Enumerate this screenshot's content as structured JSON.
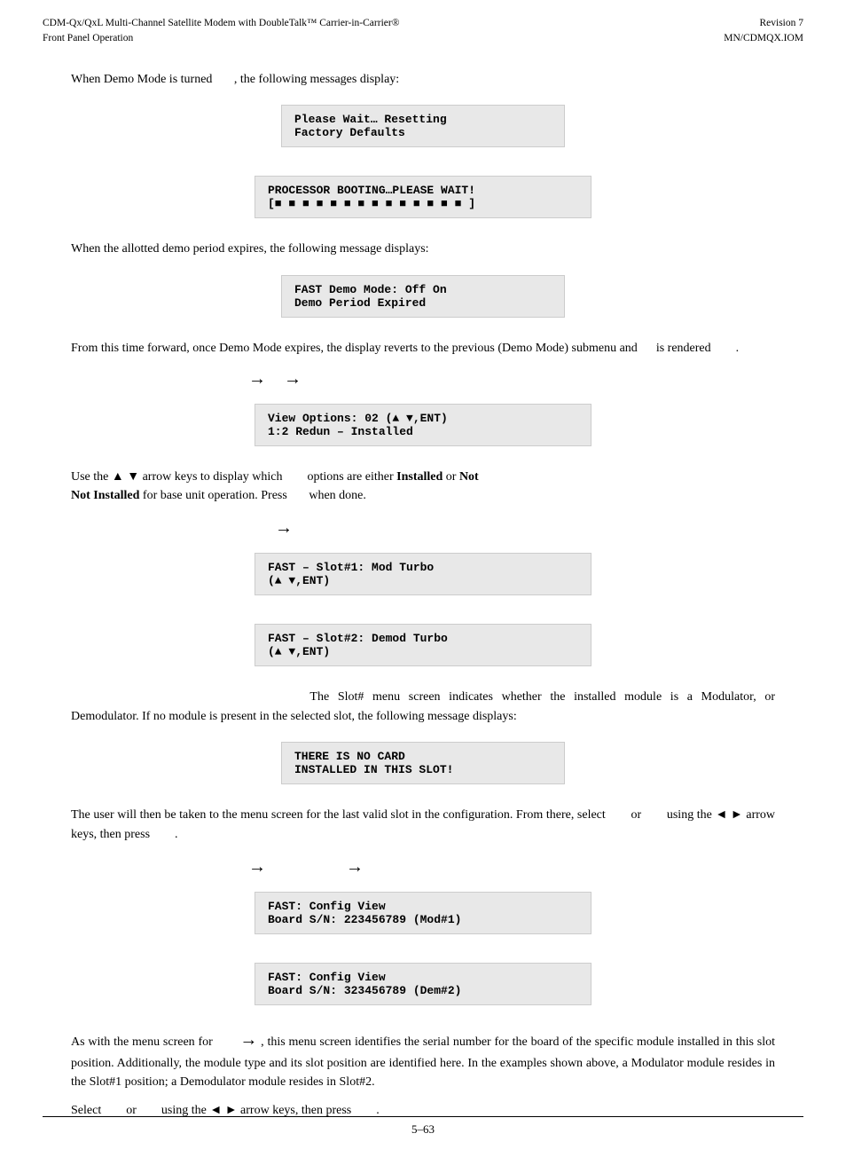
{
  "header": {
    "left_line1": "CDM-Qx/QxL Multi-Channel Satellite Modem with DoubleTalk™ Carrier-in-Carrier®",
    "left_line2": "Front Panel Operation",
    "right_line1": "Revision 7",
    "right_line2": "MN/CDMQX.IOM"
  },
  "footer": {
    "page_number": "5–63"
  },
  "content": {
    "para1_before": "When Demo Mode is turned",
    "para1_suffix": ", the following messages display:",
    "code1_line1": "Please Wait… Resetting",
    "code1_line2": "Factory Defaults",
    "code2_line1": "PROCESSOR BOOTING…PLEASE WAIT!",
    "code2_line2": "[■ ■ ■ ■ ■ ■ ■ ■ ■ ■ ■ ■ ■ ■    ]",
    "para2": "When the allotted demo period expires, the following message displays:",
    "code3_line1": "FAST Demo Mode: Off  On",
    "code3_line2": " Demo Period Expired",
    "para3_before": "From this time forward, once Demo Mode expires, the display reverts to the previous (Demo Mode) submenu and",
    "para3_mid": "is rendered",
    "para3_end": ".",
    "arrow1": "→",
    "arrow2": "→",
    "code4_line1": "View Options: 02     (▲ ▼,ENT)",
    "code4_line2": "1:2 Redun  – Installed",
    "para4_before": "Use the ▲ ▼ arrow keys to display which",
    "para4_mid": "options are either",
    "para4_bold1": "Installed",
    "para4_or": "or",
    "para4_bold2": "Not Installed",
    "para4_end": "for base unit operation. Press",
    "para4_done": "when done.",
    "arrow3": "→",
    "code5_line1": "FAST – Slot#1: Mod      Turbo",
    "code5_line2": "                   (▲ ▼,ENT)",
    "code6_line1": "FAST – Slot#2: Demod    Turbo",
    "code6_line2": "                   (▲ ▼,ENT)",
    "para5_before": "The Slot# menu screen  indicates whether the installed module is a Modulator, or Demodulator. If no module is present in the selected slot, the following message displays:",
    "code7_line1": "   THERE IS NO CARD",
    "code7_line2": "INSTALLED IN THIS SLOT!",
    "para6": "The user will then be taken to the menu screen for the last valid slot in the configuration. From there, select",
    "para6_or": "or",
    "para6_using": "using the ◄ ► arrow keys, then press",
    "para6_end": ".",
    "arrow4": "→",
    "arrow5": "→",
    "code8_line1": "FAST: Config  View",
    "code8_line2": "Board S/N: 223456789   (Mod#1)",
    "code9_line1": "FAST: Config  View",
    "code9_line2": "Board S/N: 323456789   (Dem#2)",
    "para7_before": "As with the menu screen for",
    "para7_arrow": "→",
    "para7_mid": ", this menu screen identifies the serial number for the board of the specific module installed in this slot position. Additionally, the module type and its slot position are identified here. In the examples shown above, a Modulator module resides in the Slot#1 position; a Demodulator module resides in Slot#2.",
    "para8_select": "Select",
    "para8_or": "or",
    "para8_using": "using the ◄ ► arrow keys, then press",
    "para8_end": "."
  }
}
